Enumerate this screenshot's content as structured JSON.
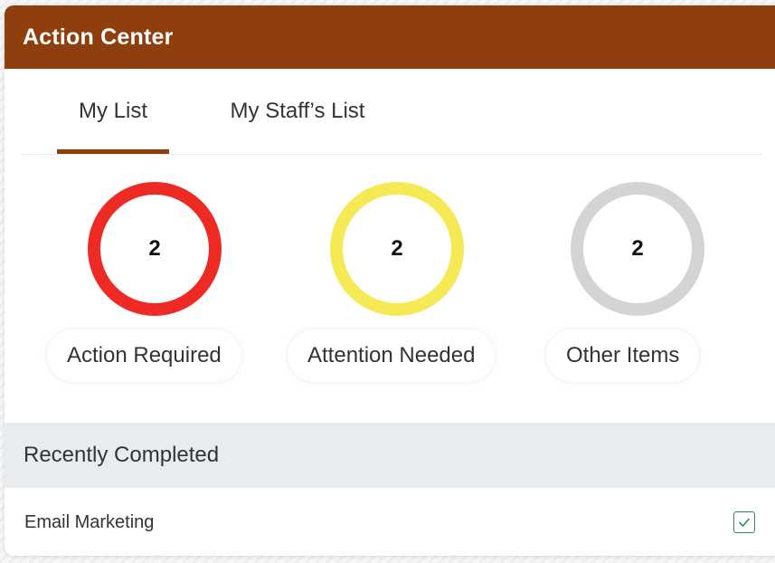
{
  "panel": {
    "title": "Action Center",
    "header_color": "#8f3f0e"
  },
  "tabs": [
    {
      "label": "My List",
      "active": true
    },
    {
      "label": "My Staff’s List",
      "active": false
    }
  ],
  "counters": [
    {
      "value": "2",
      "label": "Action Required",
      "ring_color": "#ee2a24"
    },
    {
      "value": "2",
      "label": "Attention Needed",
      "ring_color": "#f5ea55"
    },
    {
      "value": "2",
      "label": "Other Items",
      "ring_color": "#d4d4d4"
    }
  ],
  "recently_completed": {
    "title": "Recently Completed",
    "items": [
      {
        "label": "Email Marketing",
        "icon": "checkbox-checked-icon",
        "check_color": "#2e8b57"
      }
    ]
  }
}
